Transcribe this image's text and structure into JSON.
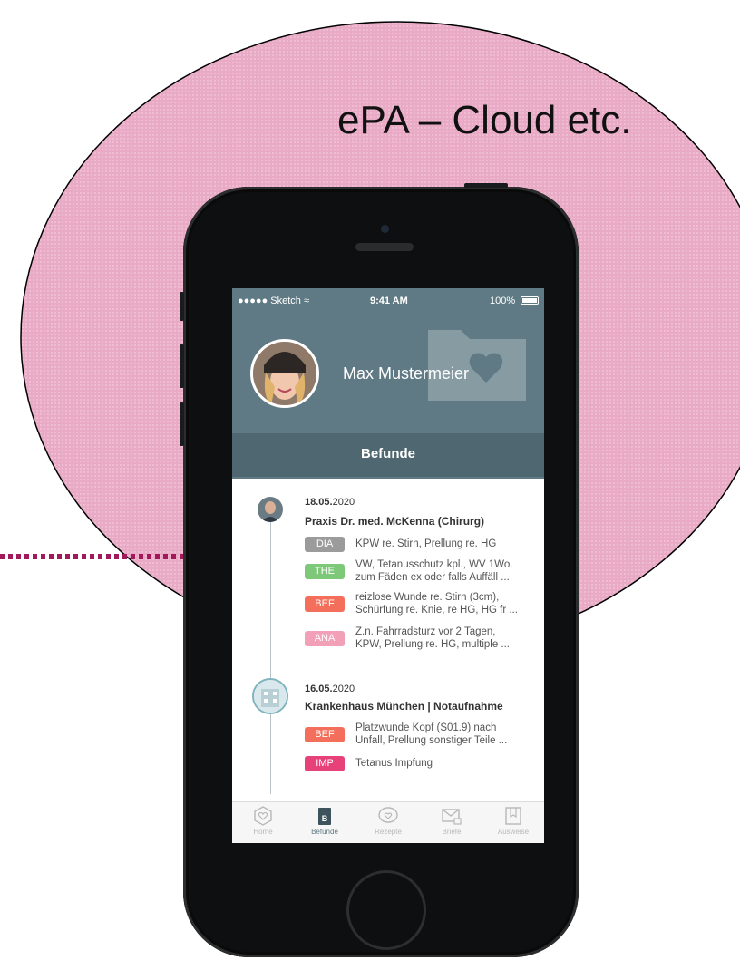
{
  "headline": "ePA – Cloud etc.",
  "colors": {
    "cloud_fill": "#e9aac6",
    "arrow": "#a3185a",
    "header_bg": "#5f7a84",
    "header_band": "#4f6770",
    "tag_dia": "#9b9b9b",
    "tag_the": "#7ec87a",
    "tag_bef": "#f36f5c",
    "tag_ana": "#f2a0b8",
    "tag_imp": "#e7417a"
  },
  "status_bar": {
    "carrier": "●●●●● Sketch ≈",
    "time": "9:41 AM",
    "battery": "100%"
  },
  "profile": {
    "name": "Max Mustermeier"
  },
  "section_title": "Befunde",
  "entries": [
    {
      "date_bold": "18.05.",
      "date_rest": "2020",
      "title": "Praxis Dr. med. McKenna (Chirurg)",
      "findings": [
        {
          "tag": "DIA",
          "text": "KPW re. Stirn, Prellung re. HG"
        },
        {
          "tag": "THE",
          "text": "VW, Tetanusschutz kpl., WV 1Wo.\nzum Fäden ex oder falls Auffäll ..."
        },
        {
          "tag": "BEF",
          "text": "reizlose Wunde re. Stirn (3cm),\nSchürfung re. Knie, re HG, HG fr ..."
        },
        {
          "tag": "ANA",
          "text": "Z.n. Fahrradsturz vor 2 Tagen,\nKPW, Prellung re. HG, multiple  ..."
        }
      ]
    },
    {
      "date_bold": "16.05.",
      "date_rest": "2020",
      "title": "Krankenhaus München | Notaufnahme",
      "findings": [
        {
          "tag": "BEF",
          "text": "Platzwunde Kopf (S01.9) nach\nUnfall, Prellung sonstiger Teile ..."
        },
        {
          "tag": "IMP",
          "text": "Tetanus Impfung"
        }
      ]
    }
  ],
  "tabs": [
    {
      "label": "Home",
      "icon": "heart-circle-icon"
    },
    {
      "label": "Befunde",
      "icon": "book-icon"
    },
    {
      "label": "Rezepte",
      "icon": "chat-heart-icon"
    },
    {
      "label": "Briefe",
      "icon": "mail-lock-icon"
    },
    {
      "label": "Ausweise",
      "icon": "bookmark-icon"
    }
  ],
  "active_tab": "Befunde"
}
